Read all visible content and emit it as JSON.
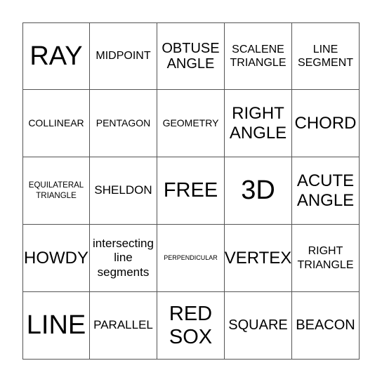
{
  "bingo": {
    "rows": [
      [
        "RAY",
        "MIDPOINT",
        "OBTUSE ANGLE",
        "SCALENE TRIANGLE",
        "LINE SEGMENT"
      ],
      [
        "COLLINEAR",
        "PENTAGON",
        "GEOMETRY",
        "RIGHT ANGLE",
        "CHORD"
      ],
      [
        "EQUILATERAL TRIANGLE",
        "SHELDON",
        "FREE",
        "3D",
        "ACUTE ANGLE"
      ],
      [
        "HOWDY",
        "intersecting line segments",
        "PERPENDICULAR",
        "VERTEX",
        "RIGHT TRIANGLE"
      ],
      [
        "LINE",
        "PARALLEL",
        "RED SOX",
        "SQUARE",
        "BEACON"
      ]
    ]
  }
}
